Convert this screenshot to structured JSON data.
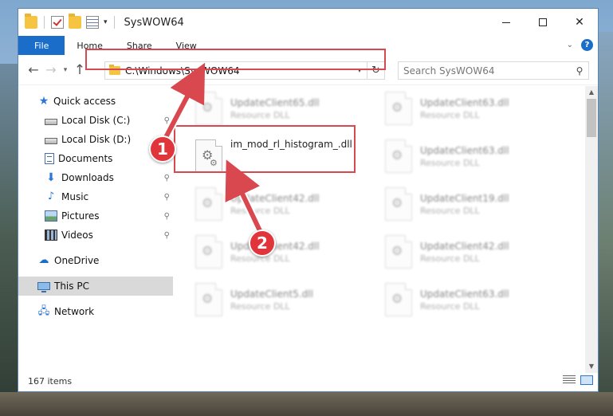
{
  "window": {
    "title": "SysWOW64",
    "minimize_icon": "minimize-icon",
    "maximize_icon": "maximize-icon",
    "close_glyph": "✕"
  },
  "ribbon": {
    "tabs": [
      {
        "label": "File"
      },
      {
        "label": "Home"
      },
      {
        "label": "Share"
      },
      {
        "label": "View"
      }
    ],
    "help_glyph": "?"
  },
  "navigation": {
    "back_glyph": "←",
    "forward_glyph": "→",
    "recent_glyph": "▾",
    "up_glyph": "↑"
  },
  "address": {
    "path": "C:\\Windows\\SysWOW64",
    "dropdown_glyph": "▾",
    "refresh_glyph": "↻"
  },
  "search": {
    "placeholder": "Search SysWOW64",
    "icon_glyph": "⚲"
  },
  "sidebar": {
    "items": [
      {
        "label": "Quick access",
        "icon": "star-icon",
        "pinned": false
      },
      {
        "label": "Local Disk (C:)",
        "icon": "drive-icon",
        "pinned": true
      },
      {
        "label": "Local Disk (D:)",
        "icon": "drive-icon",
        "pinned": false
      },
      {
        "label": "Documents",
        "icon": "documents-icon",
        "pinned": true
      },
      {
        "label": "Downloads",
        "icon": "download-icon",
        "pinned": true
      },
      {
        "label": "Music",
        "icon": "music-icon",
        "pinned": true
      },
      {
        "label": "Pictures",
        "icon": "pictures-icon",
        "pinned": true
      },
      {
        "label": "Videos",
        "icon": "videos-icon",
        "pinned": true
      },
      {
        "label": "OneDrive",
        "icon": "cloud-icon",
        "pinned": false
      },
      {
        "label": "This PC",
        "icon": "computer-icon",
        "pinned": false,
        "selected": true
      },
      {
        "label": "Network",
        "icon": "network-icon",
        "pinned": false
      }
    ],
    "pin_glyph": "📌"
  },
  "files": {
    "highlighted": {
      "name": "im_mod_rl_histogram_.dll"
    },
    "blurred": [
      {
        "name": "UpdateClient65.dll",
        "type": "Resource DLL"
      },
      {
        "name": "UpdateClient63.dll",
        "type": "Resource DLL"
      },
      {
        "name": "UpdateClient63.dll",
        "type": "Resource DLL"
      },
      {
        "name": "UpdateClient42.dll",
        "type": "Resource DLL"
      },
      {
        "name": "UpdateClient19.dll",
        "type": "Resource DLL"
      },
      {
        "name": "UpdateClient42.dll",
        "type": "Resource DLL"
      },
      {
        "name": "UpdateClient42.dll",
        "type": "Resource DLL"
      },
      {
        "name": "UpdateClient5.dll",
        "type": "Resource DLL"
      },
      {
        "name": "UpdateClient63.dll",
        "type": "Resource DLL"
      }
    ]
  },
  "status": {
    "item_count": "167 items"
  },
  "annotations": {
    "step1": "1",
    "step2": "2",
    "color": "#d9484f"
  },
  "colors": {
    "accent": "#1a6ec9",
    "selected_bg": "#d9d9d9"
  }
}
